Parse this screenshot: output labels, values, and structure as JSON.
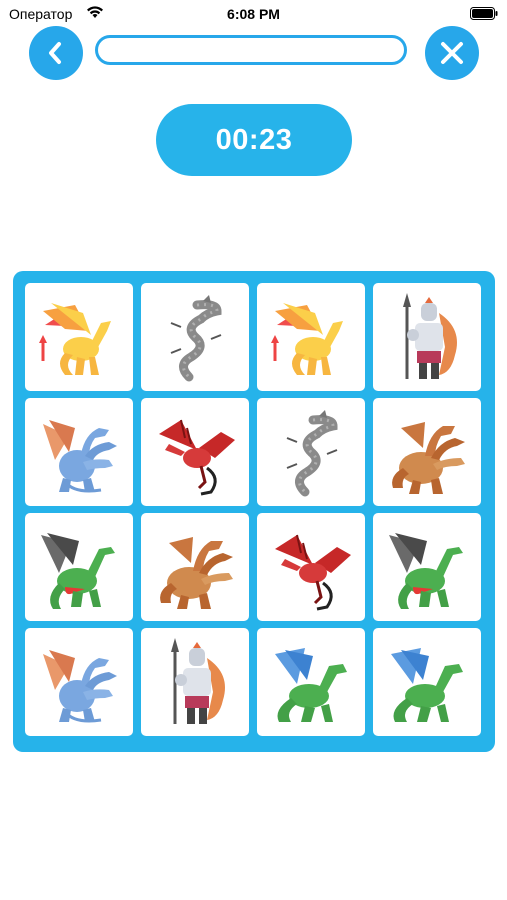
{
  "status_bar": {
    "carrier": "Оператор",
    "time": "6:08 PM",
    "wifi_icon": "wifi-icon",
    "battery_icon": "battery-icon"
  },
  "nav": {
    "back_icon": "chevron-left-icon",
    "close_icon": "close-icon",
    "progress_fraction": 0.0,
    "accent_color": "#27a7ea"
  },
  "timer": {
    "value": "00:23",
    "color": "#27b3ea"
  },
  "board": {
    "columns": 4,
    "rows": 4,
    "background_color": "#26b3ea",
    "cards": [
      {
        "image": "golden-wyvern"
      },
      {
        "image": "gray-serpent-dragon"
      },
      {
        "image": "golden-wyvern"
      },
      {
        "image": "armored-knight"
      },
      {
        "image": "blue-hydra"
      },
      {
        "image": "red-wyvern"
      },
      {
        "image": "gray-serpent-dragon"
      },
      {
        "image": "brown-hydra"
      },
      {
        "image": "green-dragon"
      },
      {
        "image": "brown-hydra"
      },
      {
        "image": "red-wyvern"
      },
      {
        "image": "green-dragon"
      },
      {
        "image": "blue-hydra"
      },
      {
        "image": "armored-knight"
      },
      {
        "image": "green-blue-dragon"
      },
      {
        "image": "green-blue-dragon"
      }
    ]
  }
}
